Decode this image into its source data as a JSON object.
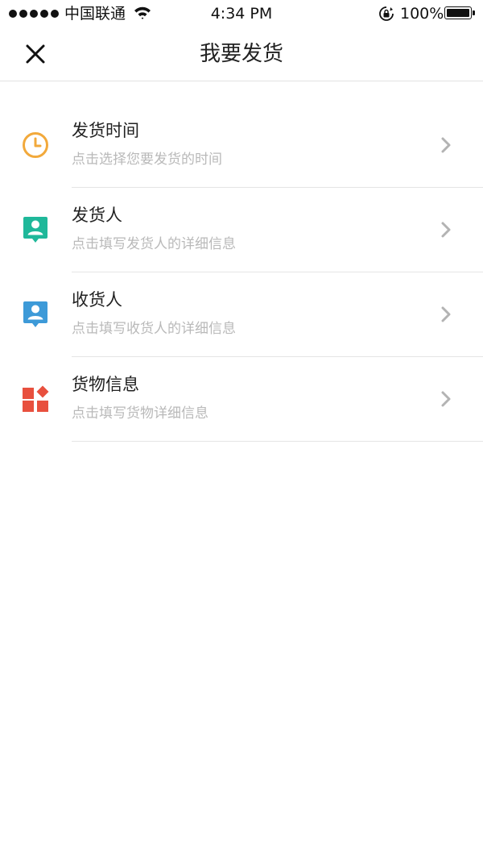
{
  "status_bar": {
    "carrier": "中国联通",
    "time": "4:34 PM",
    "battery": "100%"
  },
  "nav": {
    "title": "我要发货",
    "close_icon": "close-icon"
  },
  "items": [
    {
      "title": "发货时间",
      "subtitle": "点击选择您要发货的时间",
      "icon": "clock-icon",
      "color": "#f2a93b"
    },
    {
      "title": "发货人",
      "subtitle": "点击填写发货人的详细信息",
      "icon": "sender-contact-icon",
      "color": "#1fb89a"
    },
    {
      "title": "收货人",
      "subtitle": "点击填写收货人的详细信息",
      "icon": "receiver-contact-icon",
      "color": "#3d9ad8"
    },
    {
      "title": "货物信息",
      "subtitle": "点击填写货物详细信息",
      "icon": "goods-blocks-icon",
      "color": "#e8503e"
    }
  ],
  "colors": {
    "title_text": "#222222",
    "subtitle_text": "#b9b9b9",
    "divider": "#e5e5e5",
    "chevron": "#b3b3b3"
  }
}
